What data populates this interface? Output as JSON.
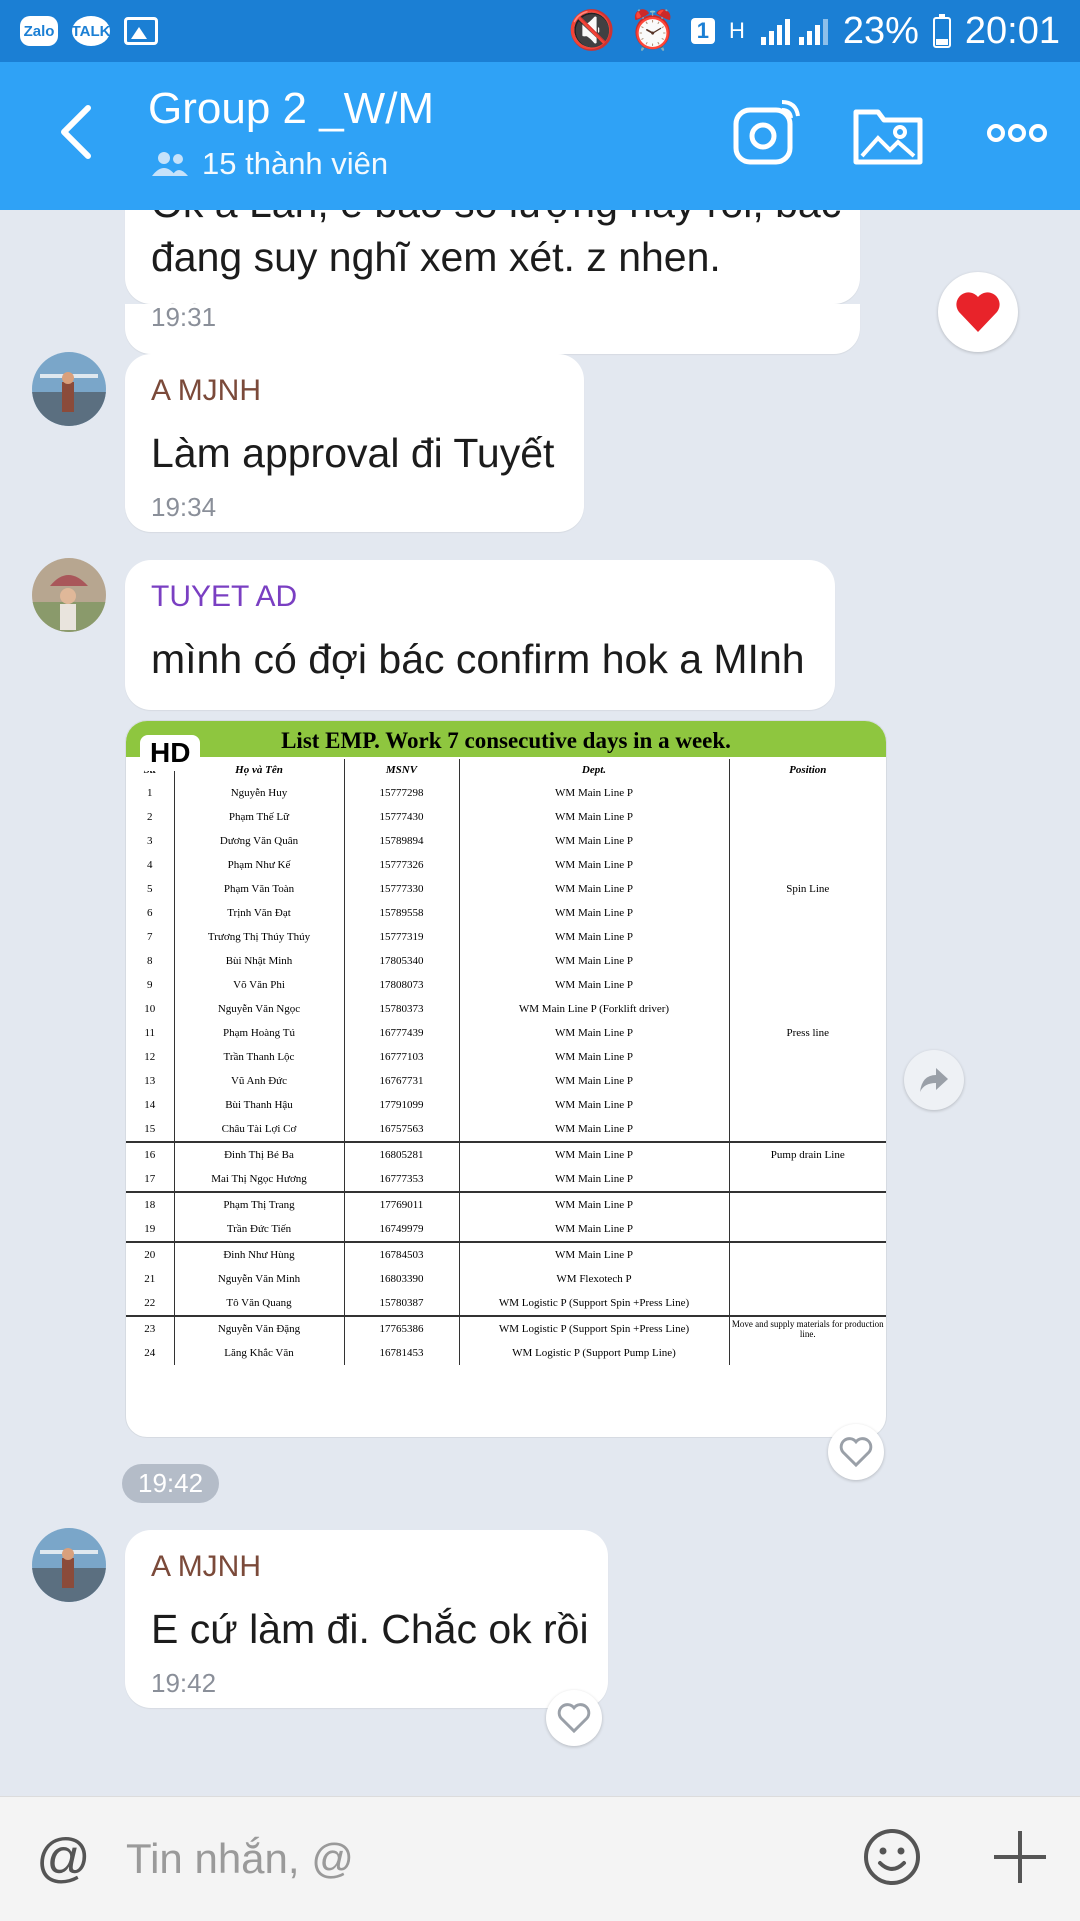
{
  "status_bar": {
    "left_labels": [
      "Zalo",
      "TALK"
    ],
    "sim_badge": "1",
    "network": "H",
    "battery": "23%",
    "time": "20:01"
  },
  "header": {
    "title": "Group 2 _W/M",
    "members": "15 thành viên"
  },
  "messages": [
    {
      "type": "text",
      "lines": [
        "Ok a Lân, e báo số lượng này rồi, bác",
        "đang suy nghĩ xem xét. z nhen."
      ],
      "time": "19:31",
      "reaction": "heart"
    },
    {
      "type": "text",
      "sender": "A MJNH",
      "sender_color": "#7b4a3a",
      "text": "Làm approval đi Tuyết",
      "time": "19:34"
    },
    {
      "type": "text",
      "sender": "TUYET AD",
      "sender_color": "#7a3fc2",
      "text": "mình có đợi bác confirm hok a MInh"
    },
    {
      "type": "image",
      "badge": "HD",
      "image_title": "List EMP. Work 7 consecutive days in a week.",
      "time": "19:42"
    },
    {
      "type": "text",
      "sender": "A MJNH",
      "sender_color": "#7b4a3a",
      "text": "E cứ làm đi. Chắc ok rồi",
      "time": "19:42"
    }
  ],
  "table": {
    "headers": [
      "Stt",
      "Họ và Tên",
      "MSNV",
      "Dept.",
      "Position"
    ],
    "rows": [
      [
        "1",
        "Nguyễn Huy",
        "15777298",
        "WM Main Line P",
        ""
      ],
      [
        "2",
        "Phạm Thế Lữ",
        "15777430",
        "WM Main Line P",
        ""
      ],
      [
        "3",
        "Dương Văn Quân",
        "15789894",
        "WM Main Line P",
        ""
      ],
      [
        "4",
        "Phạm Như Kế",
        "15777326",
        "WM Main Line P",
        ""
      ],
      [
        "5",
        "Phạm Văn Toàn",
        "15777330",
        "WM Main Line P",
        "Spin Line"
      ],
      [
        "6",
        "Trịnh Văn Đạt",
        "15789558",
        "WM Main Line P",
        ""
      ],
      [
        "7",
        "Trương Thị Thúy Thúy",
        "15777319",
        "WM Main Line P",
        ""
      ],
      [
        "8",
        "Bùi Nhật Minh",
        "17805340",
        "WM Main Line P",
        ""
      ],
      [
        "9",
        "Võ Văn Phi",
        "17808073",
        "WM Main Line P",
        ""
      ],
      [
        "10",
        "Nguyễn Văn Ngọc",
        "15780373",
        "WM Main Line P (Forklift driver)",
        ""
      ],
      [
        "11",
        "Phạm Hoàng Tú",
        "16777439",
        "WM Main Line P",
        "Press line"
      ],
      [
        "12",
        "Trần Thanh Lộc",
        "16777103",
        "WM Main Line P",
        ""
      ],
      [
        "13",
        "Vũ Anh Đức",
        "16767731",
        "WM Main Line P",
        ""
      ],
      [
        "14",
        "Bùi Thanh Hậu",
        "17791099",
        "WM Main Line P",
        ""
      ],
      [
        "15",
        "Châu Tài Lợi Cơ",
        "16757563",
        "WM Main Line P",
        ""
      ],
      [
        "16",
        "Đinh Thị Bé Ba",
        "16805281",
        "WM Main Line P",
        "Pump drain Line"
      ],
      [
        "17",
        "Mai Thị Ngọc Hương",
        "16777353",
        "WM Main Line P",
        ""
      ],
      [
        "18",
        "Phạm Thị Trang",
        "17769011",
        "WM Main Line P",
        ""
      ],
      [
        "19",
        "Trần Đức Tiến",
        "16749979",
        "WM Main Line P",
        ""
      ],
      [
        "20",
        "Đinh Như Hùng",
        "16784503",
        "WM Main Line P",
        ""
      ],
      [
        "21",
        "Nguyễn Văn Minh",
        "16803390",
        "WM Flexotech P",
        ""
      ],
      [
        "22",
        "Tô Văn Quang",
        "15780387",
        "WM Logistic P (Support Spin +Press Line)",
        ""
      ],
      [
        "23",
        "Nguyễn Văn Đặng",
        "17765386",
        "WM Logistic P (Support Spin +Press Line)",
        "Move and supply materials for production line."
      ],
      [
        "24",
        "Lăng Khắc Văn",
        "16781453",
        "WM Logistic P (Support Pump Line)",
        ""
      ]
    ]
  },
  "input": {
    "at_symbol": "@",
    "placeholder": "Tin nhắn, @"
  },
  "colors": {
    "status_bar": "#1b7fd4",
    "header": "#2fa2f6",
    "chat_bg": "#e3e8f0",
    "heart": "#e8232a",
    "image_title_bar": "#8ec63f"
  }
}
